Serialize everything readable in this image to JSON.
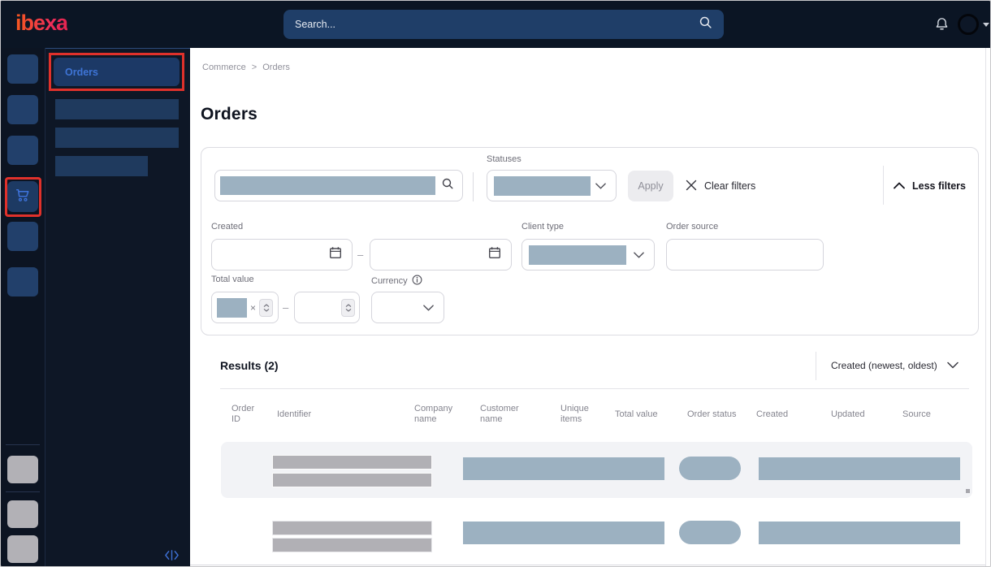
{
  "topbar": {
    "logo_text": "ibexa",
    "search_placeholder": "Search..."
  },
  "sidebar": {
    "active_item_label": "Orders"
  },
  "breadcrumb": {
    "section": "Commerce",
    "separator": ">",
    "current": "Orders"
  },
  "page": {
    "title": "Orders"
  },
  "filters": {
    "statuses_label": "Statuses",
    "apply_label": "Apply",
    "clear_filters_label": "Clear filters",
    "less_filters_label": "Less filters",
    "created_label": "Created",
    "client_type_label": "Client type",
    "order_source_label": "Order source",
    "total_value_label": "Total value",
    "currency_label": "Currency",
    "range_separator": "–",
    "multiply_sign": "×"
  },
  "results": {
    "title": "Results (2)",
    "sort_label": "Created (newest, oldest)",
    "row_count": 2,
    "columns": [
      "Order ID",
      "Identifier",
      "Company name",
      "Customer name",
      "Unique items",
      "Total value",
      "Order status",
      "Created",
      "Updated",
      "Source"
    ]
  },
  "icons": {
    "search-icon": "magnifier",
    "bell-icon": "notification bell",
    "cart-icon": "shopping cart",
    "calendar-icon": "calendar",
    "chevron-down-icon": "chevron down",
    "chevron-up-icon": "chevron up",
    "close-icon": "x cross",
    "info-icon": "circled i",
    "collapse-icon": "chevrons with bar",
    "stepper-icon": "up/down arrows"
  },
  "colors": {
    "topbar_bg": "#0b1524",
    "sidebar_bg": "#0c1422",
    "annotation_red": "#e0312b",
    "redacted_blue": "#9cb1c1",
    "redacted_gray": "#b1b0b5",
    "link_blue": "#3e74d6",
    "logo_gradient_start": "#f4581f",
    "logo_gradient_end": "#e42450"
  }
}
